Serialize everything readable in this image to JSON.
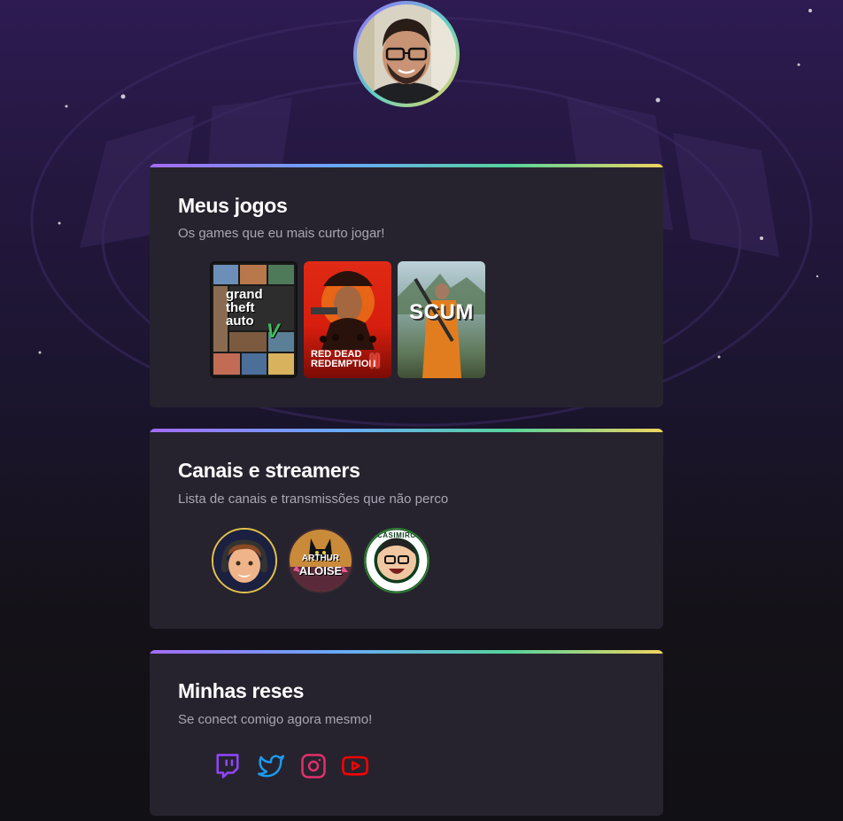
{
  "profile": {
    "avatar_icon": "user-photo"
  },
  "games_card": {
    "title": "Meus jogos",
    "subtitle": "Os games que eu mais curto jogar!",
    "games": [
      {
        "cover_text": [
          "grand",
          "theft",
          "auto"
        ],
        "badge": "V"
      },
      {
        "cover_text": [
          "RED DEAD",
          "REDEMPTION"
        ],
        "badge": "II"
      },
      {
        "cover_text": [
          "SCUM"
        ]
      }
    ]
  },
  "streamers_card": {
    "title": "Canais e streamers",
    "subtitle": "Lista de canais e transmissões que não perco",
    "streamers": [
      {
        "icon": "streamer-avatar-gamer",
        "ring": "#e3c24a"
      },
      {
        "label_top": "ARTHUR",
        "label_bottom": "ALOISE",
        "ring": "#3a2b33"
      },
      {
        "ring_text": "CASIMIRO",
        "ring": "#2e7d32"
      }
    ]
  },
  "social_card": {
    "title": "Minhas reses",
    "subtitle": "Se conect comigo agora mesmo!",
    "links": [
      {
        "icon": "twitch-icon",
        "color": "#9146ff"
      },
      {
        "icon": "twitter-icon",
        "color": "#1d9bf0"
      },
      {
        "icon": "instagram-icon",
        "color": "#e1306c"
      },
      {
        "icon": "youtube-icon",
        "color": "#ff0000"
      }
    ]
  }
}
